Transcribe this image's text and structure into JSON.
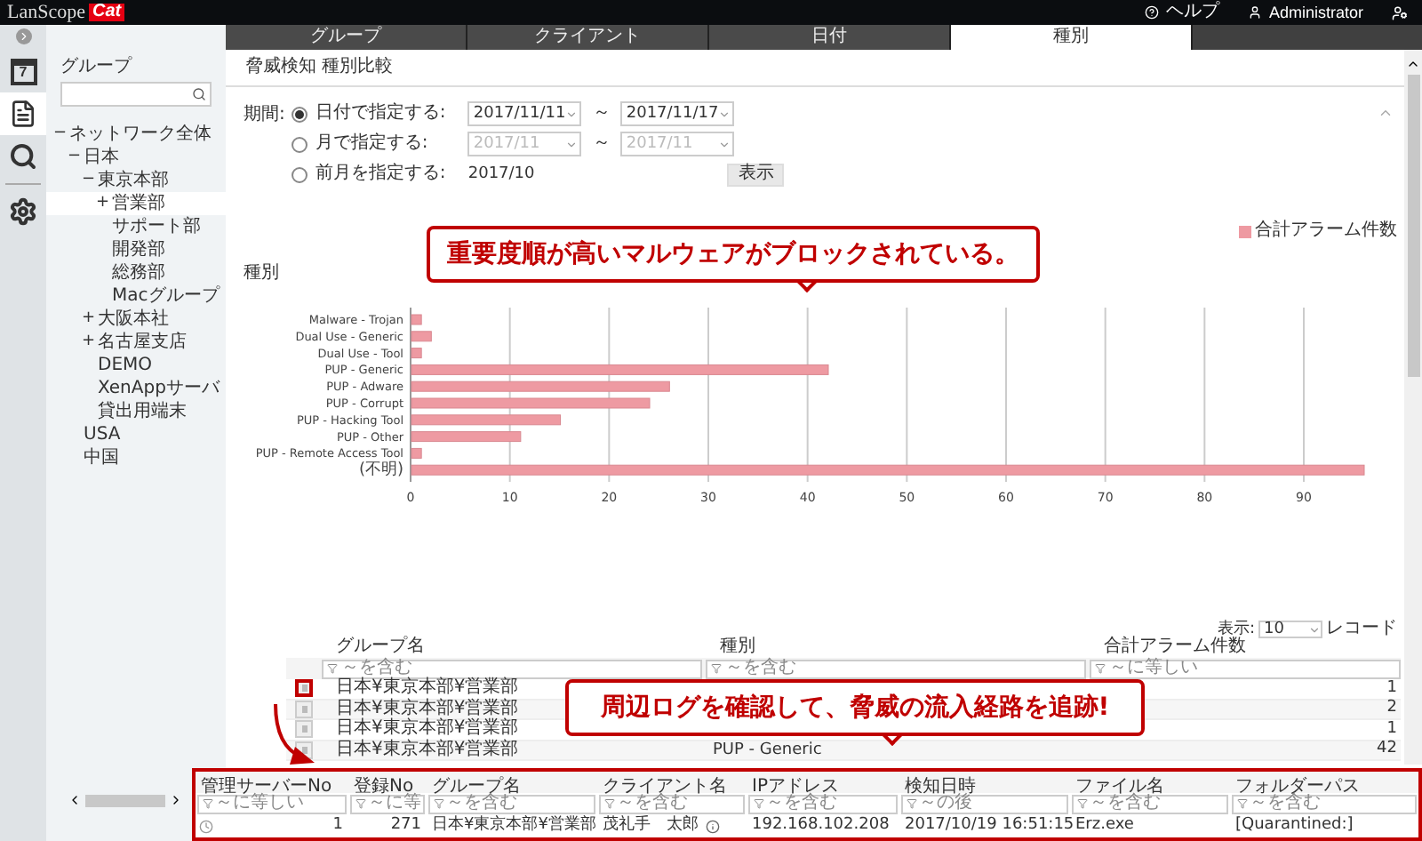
{
  "header": {
    "logo": "LanScope",
    "logo_badge": "Cat",
    "help": "ヘルプ",
    "user": "Administrator"
  },
  "rail": [
    {
      "kind": "calendar",
      "text": "7",
      "selected": false
    },
    {
      "kind": "report",
      "selected": true
    },
    {
      "kind": "search",
      "selected": false
    },
    {
      "kind": "settings",
      "selected": false
    }
  ],
  "sidebar": {
    "title": "グループ",
    "tree": [
      {
        "toggle": "−",
        "label": "ネットワーク全体",
        "selected": false,
        "children": [
          {
            "toggle": "−",
            "label": "日本",
            "selected": false,
            "children": [
              {
                "toggle": "−",
                "label": "東京本部",
                "selected": false,
                "children": [
                  {
                    "toggle": "+",
                    "label": "営業部",
                    "selected": true
                  },
                  {
                    "label": "サポート部",
                    "selected": false
                  },
                  {
                    "label": "開発部",
                    "selected": false
                  },
                  {
                    "label": "総務部",
                    "selected": false
                  },
                  {
                    "label": "Macグループ",
                    "selected": false
                  }
                ]
              },
              {
                "toggle": "+",
                "label": "大阪本社",
                "selected": false
              },
              {
                "toggle": "+",
                "label": "名古屋支店",
                "selected": false
              },
              {
                "label": "DEMO",
                "selected": false
              },
              {
                "label": "XenAppサーバ",
                "selected": false
              },
              {
                "label": "貸出用端末",
                "selected": false
              }
            ]
          },
          {
            "label": "USA",
            "selected": false
          },
          {
            "label": "中国",
            "selected": false
          }
        ]
      }
    ]
  },
  "tabs": [
    {
      "label": "グループ",
      "selected": false
    },
    {
      "label": "クライアント",
      "selected": false
    },
    {
      "label": "日付",
      "selected": false
    },
    {
      "label": "種別",
      "selected": true
    }
  ],
  "title": "脅威検知 種別比較",
  "period": {
    "label": "期間:",
    "options": [
      {
        "kind": "range",
        "label": "日付で指定する:",
        "selected": true,
        "disabled": false,
        "from": "2017/11/11",
        "sep": "～",
        "to": "2017/11/17"
      },
      {
        "kind": "range",
        "label": "月で指定する:",
        "selected": false,
        "disabled": true,
        "from": "2017/11",
        "sep": "～",
        "to": "2017/11"
      },
      {
        "kind": "fixed",
        "label": "前月を指定する:",
        "selected": false,
        "value": "2017/10"
      }
    ],
    "button": "表示"
  },
  "callouts": [
    "重要度順が高いマルウェアがブロックされている。",
    "周辺ログを確認して、脅威の流入経路を追跡!"
  ],
  "chart": {
    "label": "種別",
    "chart_data": {
      "type": "bar",
      "orientation": "horizontal",
      "categories": [
        "Malware - Trojan",
        "Dual Use - Generic",
        "Dual Use - Tool",
        "PUP - Generic",
        "PUP - Adware",
        "PUP - Corrupt",
        "PUP - Hacking Tool",
        "PUP - Other",
        "PUP - Remote Access Tool",
        "(不明)"
      ],
      "series": [
        {
          "name": "合計アラーム件数",
          "color": "#ee9aa2",
          "values": [
            1,
            2,
            1,
            42,
            26,
            24,
            15,
            11,
            1,
            96
          ]
        }
      ],
      "xticks": [
        0,
        10,
        20,
        30,
        40,
        50,
        60,
        70,
        80,
        90
      ],
      "xlim": [
        0,
        96
      ],
      "grid": true
    }
  },
  "table": {
    "page_size_label": "表示:",
    "page_size": "10",
    "page_size_suffix": "レコード",
    "columns": [
      {
        "label": "グループ名",
        "filter": "～を含む"
      },
      {
        "label": "種別",
        "filter": "～を含む"
      },
      {
        "label": "合計アラーム件数",
        "filter": "～に等しい"
      }
    ],
    "rows": [
      {
        "group": "日本¥東京本部¥営業部",
        "count": "1",
        "highlighted": true
      },
      {
        "group": "日本¥東京本部¥営業部",
        "count": "2",
        "highlighted": false
      },
      {
        "group": "日本¥東京本部¥営業部",
        "count": "1",
        "highlighted": false
      },
      {
        "group": "日本¥東京本部¥営業部",
        "type": "PUP - Generic",
        "count": "42",
        "highlighted": false
      }
    ]
  },
  "detail": {
    "columns": [
      {
        "label": "管理サーバーNo",
        "filter": "～に等しい"
      },
      {
        "label": "登録No",
        "filter": "～に等"
      },
      {
        "label": "グループ名",
        "filter": "～を含む"
      },
      {
        "label": "クライアント名",
        "filter": "～を含む"
      },
      {
        "label": "IPアドレス",
        "filter": "～を含む"
      },
      {
        "label": "検知日時",
        "filter": "～の後"
      },
      {
        "label": "ファイル名",
        "filter": "～を含む"
      },
      {
        "label": "フォルダーパス",
        "filter": "～を含む"
      }
    ],
    "rows": [
      [
        "1",
        "271",
        "日本¥東京本部¥営業部",
        "茂礼手　太郎",
        "192.168.102.208",
        "2017/10/19 16:51:15",
        "Erz.exe",
        "[Quarantined:]"
      ]
    ]
  }
}
